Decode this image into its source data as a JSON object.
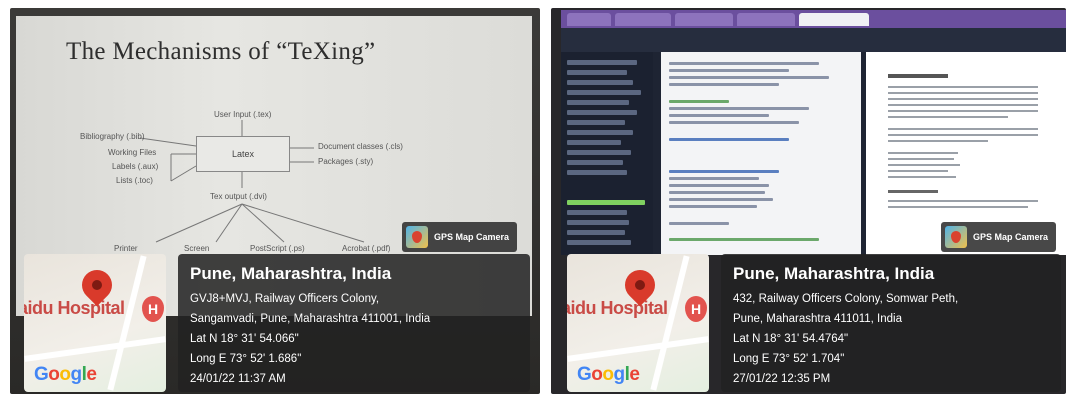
{
  "photos": [
    {
      "slide": {
        "title": "The Mechanisms of “TeXing”",
        "nodes": {
          "user_input": "User Input (.tex)",
          "bibliography": "Bibliography (.bib)",
          "working_files": "Working Files",
          "labels": "Labels (.aux)",
          "lists": "Lists (.toc)",
          "latex": "Latex",
          "document_classes": "Document classes (.cls)",
          "packages": "Packages (.sty)",
          "tex_output": "Tex output (.dvi)",
          "printer": "Printer",
          "screen": "Screen",
          "postscript": "PostScript (.ps)",
          "acrobat": "Acrobat (.pdf)"
        }
      },
      "badge": "GPS Map Camera",
      "map": {
        "place_label": "aidu Hospital",
        "hospital_marker": "H",
        "logo": "Google"
      },
      "info": {
        "title": "Pune, Maharashtra, India",
        "address_line1": "GVJ8+MVJ, Railway Officers Colony,",
        "address_line2": "Sangamvadi, Pune, Maharashtra 411001, India",
        "lat": "Lat N 18° 31' 54.066\"",
        "long": "Long E 73° 52' 1.686\"",
        "datetime": "24/01/22 11:37 AM"
      }
    },
    {
      "badge": "GPS Map Camera",
      "map": {
        "place_label": "aidu Hospital",
        "hospital_marker": "H",
        "logo": "Google"
      },
      "info": {
        "title": "Pune, Maharashtra, India",
        "address_line1": "432, Railway Officers Colony, Somwar Peth,",
        "address_line2": "Pune, Maharashtra 411011, India",
        "lat": "Lat N 18° 31' 54.4764\"",
        "long": "Long E 73° 52' 1.704\"",
        "datetime": "27/01/22 12:35 PM"
      }
    }
  ],
  "colors": {
    "overlay": "#222222",
    "pin": "#d93a2b",
    "hospital": "#c94b46",
    "browser_tabbar": "#6b4f9e"
  }
}
